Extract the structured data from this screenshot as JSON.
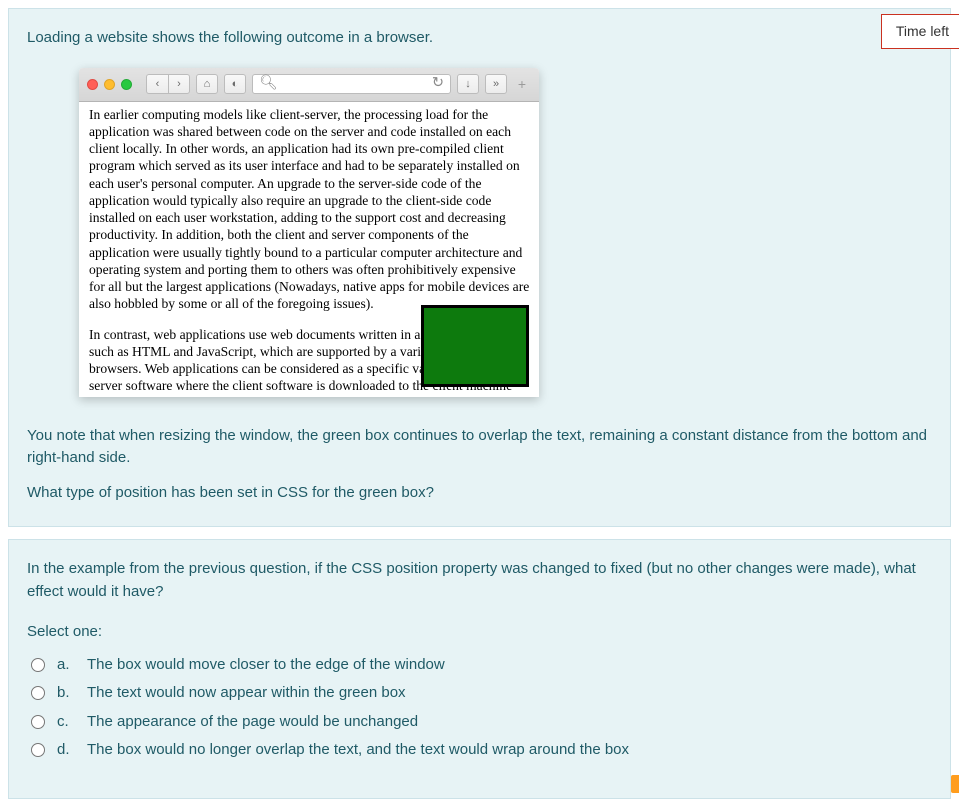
{
  "timer": {
    "label": "Time left"
  },
  "q1": {
    "intro": "Loading a website shows the following outcome in a browser.",
    "para1": "In earlier computing models like client-server, the processing load for the application was shared between code on the server and code installed on each client locally. In other words, an application had its own pre-compiled client program which served as its user interface and had to be separately installed on each user's personal computer. An upgrade to the server-side code of the application would typically also require an upgrade to the client-side code installed on each user workstation, adding to the support cost and decreasing productivity. In addition, both the client and server components of the application were usually tightly bound to a particular computer architecture and operating system and porting them to others was often prohibitively expensive for all but the largest applications (Nowadays, native apps for mobile devices are also hobbled by some or all of the foregoing issues).",
    "para2": "In contrast, web applications use web documents written in a standard format such as HTML and JavaScript, which are supported by a variety of web browsers. Web applications can be considered as a specific variant of client-server software where the client software is downloaded to the client machine when visiting the relevant web page, using standard procedures such as HTTP. Client web software updates may happen each time the web page is visited. During the session, the web browser interprets and displays",
    "note1": "You note that when resizing the window, the green box continues to overlap the text, remaining a constant distance from the bottom and right-hand side.",
    "note2": "What type of position has been set in CSS for the green box?"
  },
  "q2": {
    "prompt": "In the example from the previous question, if the CSS position property was changed to fixed (but no other changes were made), what effect would it have?",
    "selectone": "Select one:",
    "options": [
      {
        "letter": "a.",
        "text": "The box would move closer to the edge of the window"
      },
      {
        "letter": "b.",
        "text": "The text would now appear within the green box"
      },
      {
        "letter": "c.",
        "text": "The appearance of the page would be unchanged"
      },
      {
        "letter": "d.",
        "text": "The box would no longer overlap the text, and the text would wrap around the box"
      }
    ]
  }
}
